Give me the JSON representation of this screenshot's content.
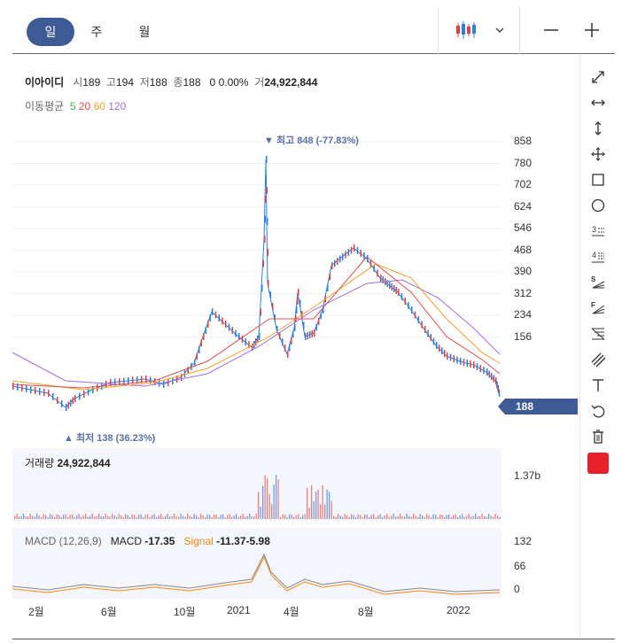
{
  "tabs": {
    "day": "일",
    "week": "주",
    "month": "월"
  },
  "stock": {
    "name": "이아이디",
    "open_label": "시",
    "open": "189",
    "high_label": "고",
    "high": "194",
    "low_label": "저",
    "low": "188",
    "close_label": "종",
    "close": "188",
    "change": "0",
    "change_pct": "0.00%",
    "volume_label": "거",
    "volume": "24,922,844"
  },
  "ma": {
    "label": "이동평균",
    "periods": [
      "5",
      "20",
      "60",
      "120"
    ],
    "colors": [
      "#4caf50",
      "#e05050",
      "#f0a030",
      "#a070e0"
    ]
  },
  "price_axis": [
    "858",
    "780",
    "702",
    "624",
    "546",
    "468",
    "390",
    "312",
    "234",
    "156"
  ],
  "current_price": "188",
  "high_marker": "▼ 최고 848 (-77.83%)",
  "low_marker": "▲ 최저 138 (36.23%)",
  "volume_panel": {
    "label": "거래량",
    "value": "24,922,844",
    "axis": "1.37b"
  },
  "macd_panel": {
    "params": "MACD (12,26,9)",
    "macd_label": "MACD",
    "macd_value": "-17.35",
    "signal_label": "Signal",
    "signal_value": "-11.37",
    "hist_value": "-5.98",
    "axis": [
      "132",
      "66",
      "0"
    ],
    "signal_color": "#f08a1a"
  },
  "time_axis": [
    "2월",
    "6월",
    "10월",
    "2021",
    "4월",
    "8월",
    "2022"
  ],
  "colors": {
    "accent": "#3f5b96",
    "up": "#e04040",
    "down": "#2a7fe0",
    "drawing_color": "#e8202a"
  },
  "right_tools": [
    "expand-icon",
    "horizontal-resize-icon",
    "vertical-resize-icon",
    "move-icon",
    "rectangle-icon",
    "circle-icon",
    "fib-3-icon",
    "fib-4-icon",
    "s-fan-icon",
    "f-fan-icon",
    "gann-icon",
    "parallel-lines-icon",
    "text-icon",
    "undo-icon",
    "trash-icon"
  ]
}
